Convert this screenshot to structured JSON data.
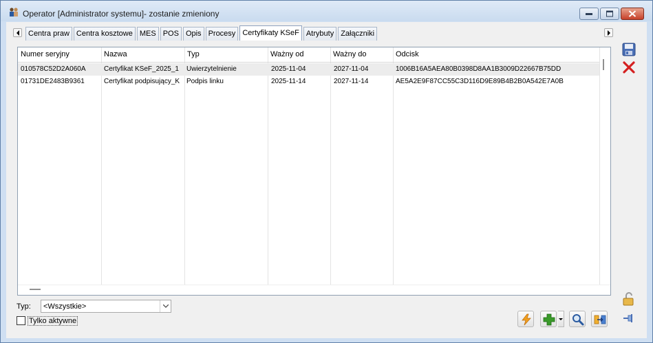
{
  "window": {
    "title": "Operator [Administrator systemu]- zostanie zmieniony",
    "app_icon": "users-icon"
  },
  "tabs": [
    {
      "label": "Centra praw",
      "active": false
    },
    {
      "label": "Centra kosztowe",
      "active": false
    },
    {
      "label": "MES",
      "active": false
    },
    {
      "label": "POS",
      "active": false
    },
    {
      "label": "Opis",
      "active": false
    },
    {
      "label": "Procesy",
      "active": false
    },
    {
      "label": "Certyfikaty KSeF",
      "active": true
    },
    {
      "label": "Atrybuty",
      "active": false
    },
    {
      "label": "Załączniki",
      "active": false
    }
  ],
  "grid": {
    "columns": [
      "Numer seryjny",
      "Nazwa",
      "Typ",
      "Ważny od",
      "Ważny do",
      "Odcisk"
    ],
    "rows": [
      [
        "010578C52D2A060A",
        "Certyfikat KSeF_2025_1",
        "Uwierzytelnienie",
        "2025-11-04",
        "2027-11-04",
        "1006B16A5AEA80B0398D8AA1B3009D22667B75DD"
      ],
      [
        "01731DE2483B9361",
        "Certyfikat podpisujący_K",
        "Podpis linku",
        "2025-11-14",
        "2027-11-14",
        "AE5A2E9F87CC55C3D116D9E89B4B2B0A542E7A0B"
      ]
    ]
  },
  "filter": {
    "typ_label": "Typ:",
    "typ_value": "<Wszystkie>",
    "only_active_label": "Tylko aktywne",
    "only_active_checked": false
  },
  "icons": {
    "save": "save-icon",
    "cancel": "close-icon",
    "lock": "padlock-icon",
    "pin": "pin-icon",
    "run": "lightning-icon",
    "add": "plus-icon",
    "search": "magnifier-icon",
    "link": "link-icon"
  },
  "colors": {
    "add_green": "#3a9a2a",
    "cancel_red": "#d42020",
    "close_button": "#c7412a"
  }
}
